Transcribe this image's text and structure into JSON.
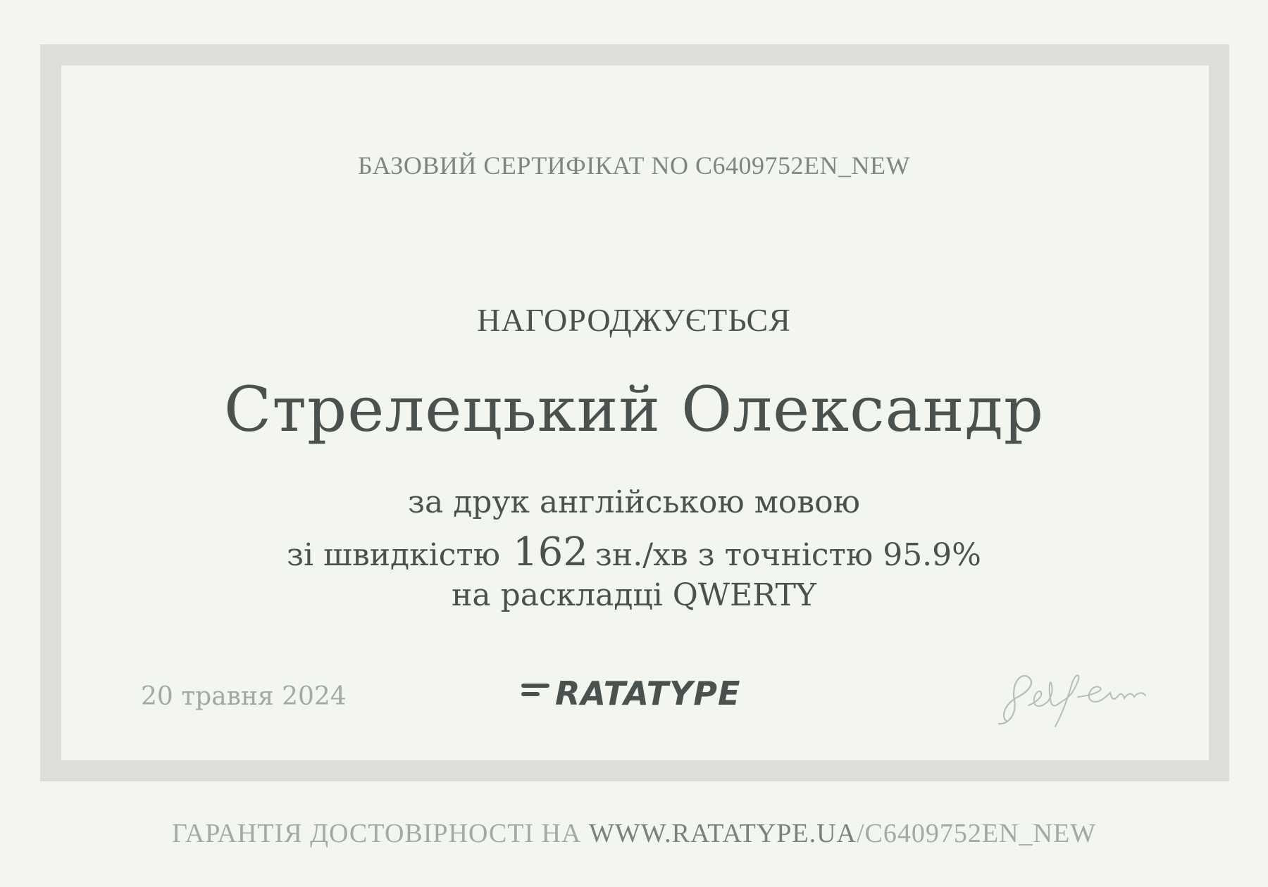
{
  "certificate": {
    "number_line": "БАЗОВИЙ СЕРТИФІКАТ NO C6409752EN_NEW",
    "awarded_label": "НАГОРОДЖУЄТЬСЯ",
    "recipient": "Стрелецький Олександр",
    "line1": "за друк англійською мовою",
    "line2_prefix": "зі швидкістю",
    "speed": "162",
    "line2_suffix": "зн./хв з точністю 95.9%",
    "line3": "на раскладці QWERTY",
    "date": "20 травня 2024",
    "logo_text": "RATATYPE"
  },
  "footer": {
    "prefix": "ГАРАНТІЯ ДОСТОВІРНОСТІ НА",
    "site": "WWW.RATATYPE.UA",
    "path": "/C6409752EN_NEW"
  },
  "colors": {
    "background": "#f3f6ef",
    "frame": "#dcdfd9",
    "text_dark": "#4a5250",
    "text_light": "#a4a9a5"
  },
  "icons": {
    "logo": "ratatype-logo-icon",
    "signature": "signature-icon"
  }
}
